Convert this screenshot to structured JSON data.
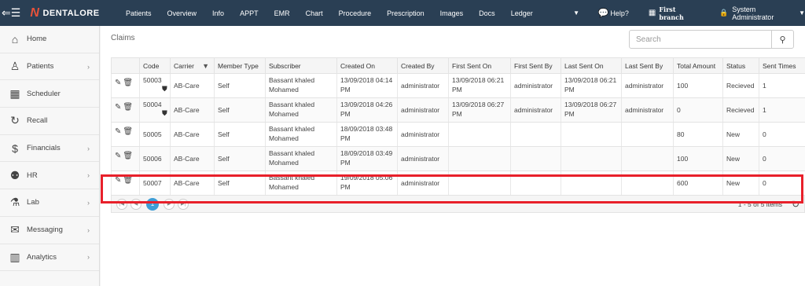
{
  "app": {
    "brand": "DENTALORE",
    "menu_icon": "hamburger-icon"
  },
  "nav": {
    "items": [
      "Patients",
      "Overview",
      "Info",
      "APPT",
      "EMR",
      "Chart",
      "Procedure",
      "Prescription",
      "Images",
      "Docs",
      "Ledger"
    ],
    "help_label": "Help?",
    "branch": "First branch",
    "user": "System Administrator"
  },
  "sidebar": {
    "items": [
      {
        "label": "Home",
        "icon": "home-icon",
        "arrow": false
      },
      {
        "label": "Patients",
        "icon": "person-icon",
        "arrow": true
      },
      {
        "label": "Scheduler",
        "icon": "calendar-icon",
        "arrow": false
      },
      {
        "label": "Recall",
        "icon": "recall-icon",
        "arrow": false
      },
      {
        "label": "Financials",
        "icon": "dollar-icon",
        "arrow": true
      },
      {
        "label": "HR",
        "icon": "users-icon",
        "arrow": true
      },
      {
        "label": "Lab",
        "icon": "flask-icon",
        "arrow": true
      },
      {
        "label": "Messaging",
        "icon": "envelope-icon",
        "arrow": true
      },
      {
        "label": "Analytics",
        "icon": "bar-chart-icon",
        "arrow": true
      }
    ]
  },
  "main": {
    "title": "Claims",
    "search": {
      "placeholder": "Search",
      "value": ""
    }
  },
  "table": {
    "columns": [
      "",
      "Code",
      "Carrier",
      "Member Type",
      "Subscriber",
      "Created On",
      "Created By",
      "First Sent On",
      "First Sent By",
      "Last Sent On",
      "Last Sent By",
      "Total Amount",
      "Status",
      "Sent Times"
    ],
    "rows": [
      {
        "code": "50003",
        "shield": true,
        "carrier": "AB-Care",
        "member_type": "Self",
        "subscriber": "Bassant khaled Mohamed",
        "created_on": "13/09/2018 04:14 PM",
        "created_by": "administrator",
        "first_sent_on": "13/09/2018 06:21 PM",
        "first_sent_by": "administrator",
        "last_sent_on": "13/09/2018 06:21 PM",
        "last_sent_by": "administrator",
        "total_amount": "100",
        "status": "Recieved",
        "sent_times": "1"
      },
      {
        "code": "50004",
        "shield": true,
        "carrier": "AB-Care",
        "member_type": "Self",
        "subscriber": "Bassant khaled Mohamed",
        "created_on": "13/09/2018 04:26 PM",
        "created_by": "administrator",
        "first_sent_on": "13/09/2018 06:27 PM",
        "first_sent_by": "administrator",
        "last_sent_on": "13/09/2018 06:27 PM",
        "last_sent_by": "administrator",
        "total_amount": "0",
        "status": "Recieved",
        "sent_times": "1"
      },
      {
        "code": "50005",
        "shield": false,
        "carrier": "AB-Care",
        "member_type": "Self",
        "subscriber": "Bassant khaled Mohamed",
        "created_on": "18/09/2018 03:48 PM",
        "created_by": "administrator",
        "first_sent_on": "",
        "first_sent_by": "",
        "last_sent_on": "",
        "last_sent_by": "",
        "total_amount": "80",
        "status": "New",
        "sent_times": "0"
      },
      {
        "code": "50006",
        "shield": false,
        "carrier": "AB-Care",
        "member_type": "Self",
        "subscriber": "Bassant khaled Mohamed",
        "created_on": "18/09/2018 03:49 PM",
        "created_by": "administrator",
        "first_sent_on": "",
        "first_sent_by": "",
        "last_sent_on": "",
        "last_sent_by": "",
        "total_amount": "100",
        "status": "New",
        "sent_times": "0"
      },
      {
        "code": "50007",
        "shield": false,
        "carrier": "AB-Care",
        "member_type": "Self",
        "subscriber": "Bassant khaled Mohamed",
        "created_on": "19/09/2018 05:06 PM",
        "created_by": "administrator",
        "first_sent_on": "",
        "first_sent_by": "",
        "last_sent_on": "",
        "last_sent_by": "",
        "total_amount": "600",
        "status": "New",
        "sent_times": "0"
      }
    ]
  },
  "pager": {
    "current_page": "1",
    "info": "1 - 5 of 5 items"
  },
  "colors": {
    "topbar": "#2a3f54",
    "accent": "#3e9ed6",
    "highlight": "#e8202a",
    "brand_mark": "#e8523a"
  }
}
